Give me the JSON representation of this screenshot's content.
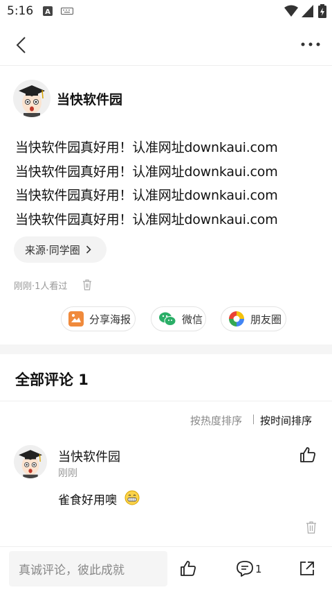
{
  "status": {
    "time": "5:16"
  },
  "post": {
    "author": "当快软件园",
    "paragraphs": [
      "当快软件园真好用！认准网址downkaui.com",
      "当快软件园真好用！认准网址downkaui.com",
      "当快软件园真好用！认准网址downkaui.com",
      "当快软件园真好用！认准网址downkaui.com"
    ],
    "source": "来源·同学圈",
    "meta": "刚刚·1人看过"
  },
  "share": {
    "poster": "分享海报",
    "wechat": "微信",
    "moments": "朋友圈"
  },
  "comments": {
    "title": "全部评论 1",
    "sort_hot": "按热度排序",
    "sort_time": "按时间排序",
    "items": [
      {
        "author": "当快软件园",
        "time": "刚刚",
        "text": "雀食好用噢"
      }
    ]
  },
  "bottom": {
    "placeholder": "真诚评论，彼此成就",
    "comment_count": "1"
  },
  "colors": {
    "accent_orange": "#f08a3c",
    "wechat_green": "#2aae67"
  }
}
